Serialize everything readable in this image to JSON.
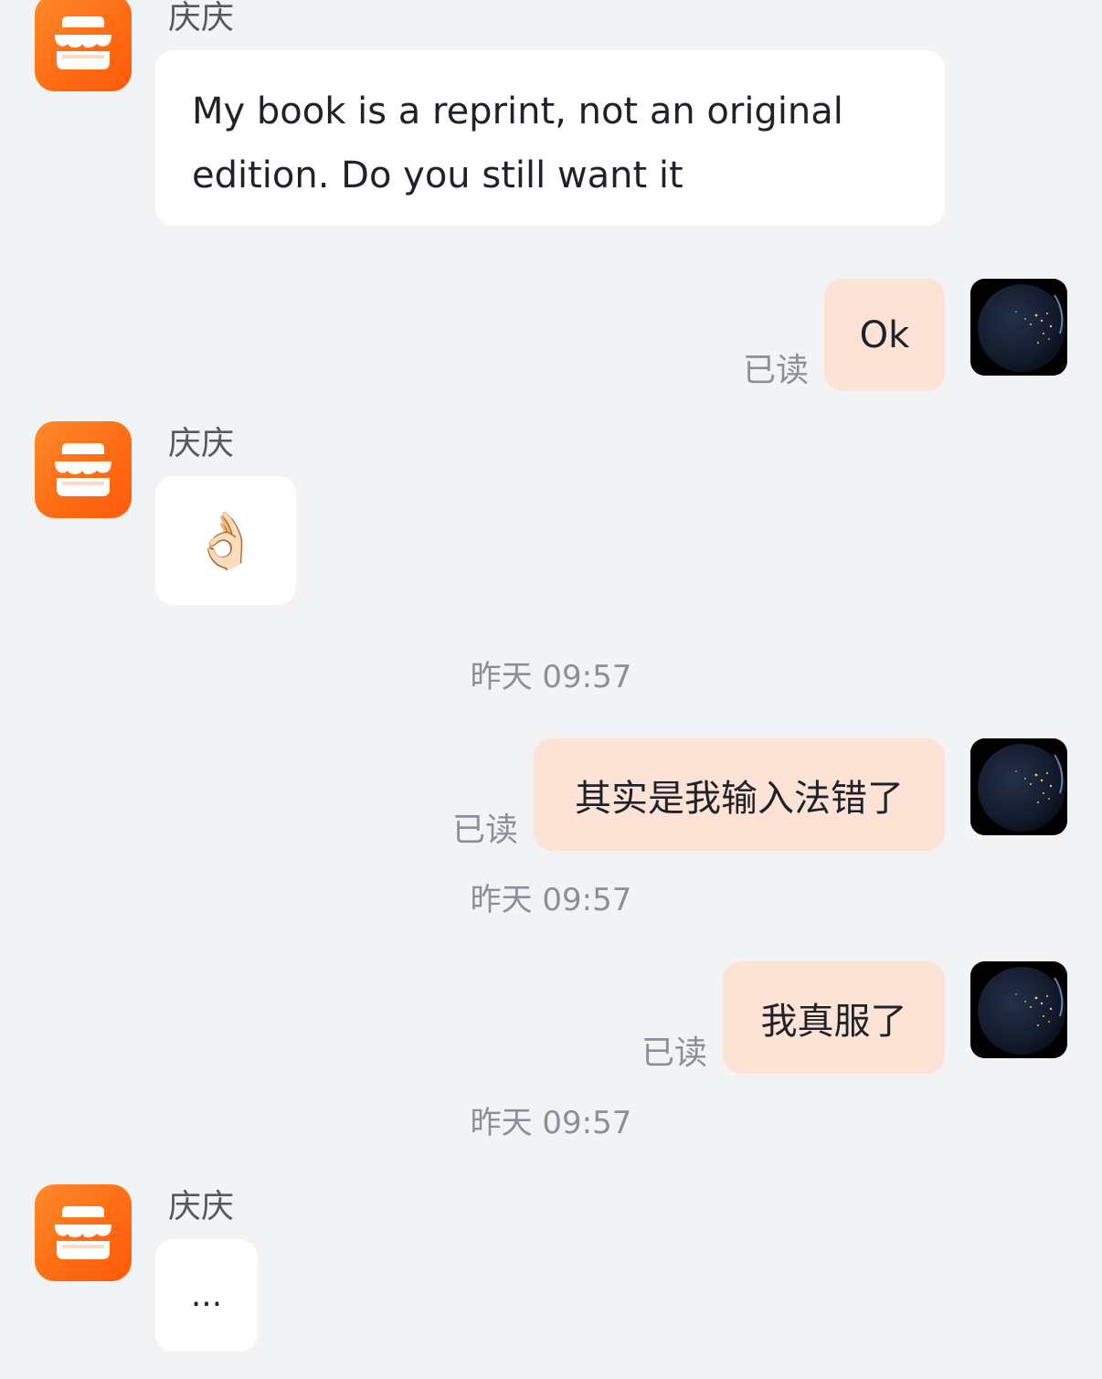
{
  "messages": [
    {
      "sender": "庆庆",
      "text": "My book is a reprint, not an original edition. Do you still want it"
    },
    {
      "text": "Ok",
      "status": "已读"
    },
    {
      "sender": "庆庆",
      "emoji": "👌🏻"
    },
    {
      "timestamp": "昨天 09:57",
      "text": "其实是我输入法错了",
      "status": "已读"
    },
    {
      "timestamp": "昨天 09:57",
      "text": "我真服了",
      "status": "已读"
    },
    {
      "timestamp": "昨天 09:57",
      "sender": "庆庆",
      "text": "..."
    }
  ],
  "colors": {
    "background": "#f2f3f5",
    "incoming_bubble": "#ffffff",
    "outgoing_bubble": "#fde3d6",
    "shop_avatar": "#ff6a12",
    "muted_text": "#8a9099"
  },
  "icons": {
    "shop_avatar": "store-icon",
    "user_avatar": "earth-icon"
  }
}
